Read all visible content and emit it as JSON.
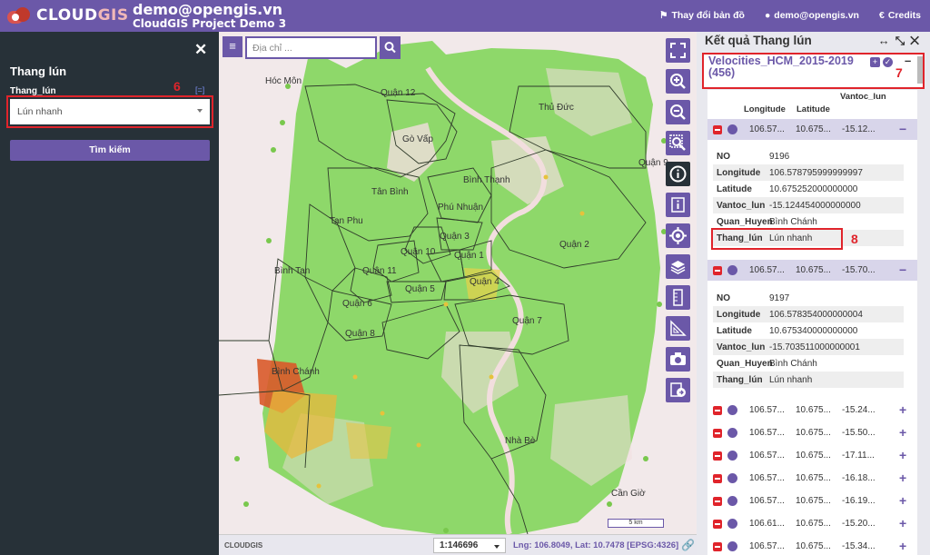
{
  "header": {
    "logo_text_a": "CLOUD",
    "logo_text_b": "GIS",
    "user": "demo@opengis.vn",
    "project": "CloudGIS Project Demo 3",
    "change_map": "Thay đổi bản đồ",
    "account": "demo@opengis.vn",
    "credits": "Credits"
  },
  "left_panel": {
    "title": "Thang lún",
    "field_label": "Thang_lún",
    "field_extra": "[=]",
    "select_value": "Lún nhanh",
    "search_button": "Tìm kiếm",
    "annotation": "6"
  },
  "map": {
    "search_placeholder": "Địa chỉ ...",
    "places": [
      "Hóc Môn",
      "Quận 12",
      "Thủ Đức",
      "Gò Vấp",
      "Quận 9",
      "Tân Bình",
      "Bình Thạnh",
      "Phú Nhuận",
      "Tan Phu",
      "Quận 3",
      "Quận 10",
      "Quận 1",
      "Quận 2",
      "Bình Tan",
      "Quận 11",
      "Quận 4",
      "Quận 5",
      "Quận 6",
      "Quận 7",
      "Quận 8",
      "Bình Chánh",
      "Nhà Bè",
      "Cần Giờ"
    ],
    "scalebar": "5 km",
    "footer_logo": "CLOUDGIS",
    "scale": "1:146696",
    "coords": "Lng: 106.8049, Lat: 10.7478",
    "epsg": "[EPSG:4326]"
  },
  "results": {
    "title": "Kết quả Thang lún",
    "layer": "Velocities_HCM_2015-2019 (456)",
    "annotation_box": "7",
    "annotation_row": "8",
    "columns": [
      "Longitude",
      "Latitude",
      "Vantoc_lun"
    ],
    "rows": [
      {
        "lon": "106.57...",
        "lat": "10.675...",
        "v": "-15.12...",
        "expanded": true
      },
      {
        "lon": "106.57...",
        "lat": "10.675...",
        "v": "-15.70...",
        "expanded": true
      },
      {
        "lon": "106.57...",
        "lat": "10.675...",
        "v": "-15.24...",
        "expanded": false
      },
      {
        "lon": "106.57...",
        "lat": "10.675...",
        "v": "-15.50...",
        "expanded": false
      },
      {
        "lon": "106.57...",
        "lat": "10.675...",
        "v": "-17.11...",
        "expanded": false
      },
      {
        "lon": "106.57...",
        "lat": "10.675...",
        "v": "-16.18...",
        "expanded": false
      },
      {
        "lon": "106.57...",
        "lat": "10.675...",
        "v": "-16.19...",
        "expanded": false
      },
      {
        "lon": "106.61...",
        "lat": "10.675...",
        "v": "-15.20...",
        "expanded": false
      },
      {
        "lon": "106.57...",
        "lat": "10.675...",
        "v": "-15.34...",
        "expanded": false
      }
    ],
    "detail1": [
      {
        "k": "NO",
        "v": "9196"
      },
      {
        "k": "Longitude",
        "v": "106.578795999999997"
      },
      {
        "k": "Latitude",
        "v": "10.675252000000000"
      },
      {
        "k": "Vantoc_lun",
        "v": "-15.124454000000000"
      },
      {
        "k": "Quan_Huyen",
        "v": "Bình Chánh"
      },
      {
        "k": "Thang_lún",
        "v": "Lún nhanh"
      }
    ],
    "detail2": [
      {
        "k": "NO",
        "v": "9197"
      },
      {
        "k": "Longitude",
        "v": "106.578354000000004"
      },
      {
        "k": "Latitude",
        "v": "10.675340000000000"
      },
      {
        "k": "Vantoc_lun",
        "v": "-15.703511000000001"
      },
      {
        "k": "Quan_Huyen",
        "v": "Bình Chánh"
      },
      {
        "k": "Thang_lún",
        "v": "Lún nhanh"
      }
    ]
  }
}
